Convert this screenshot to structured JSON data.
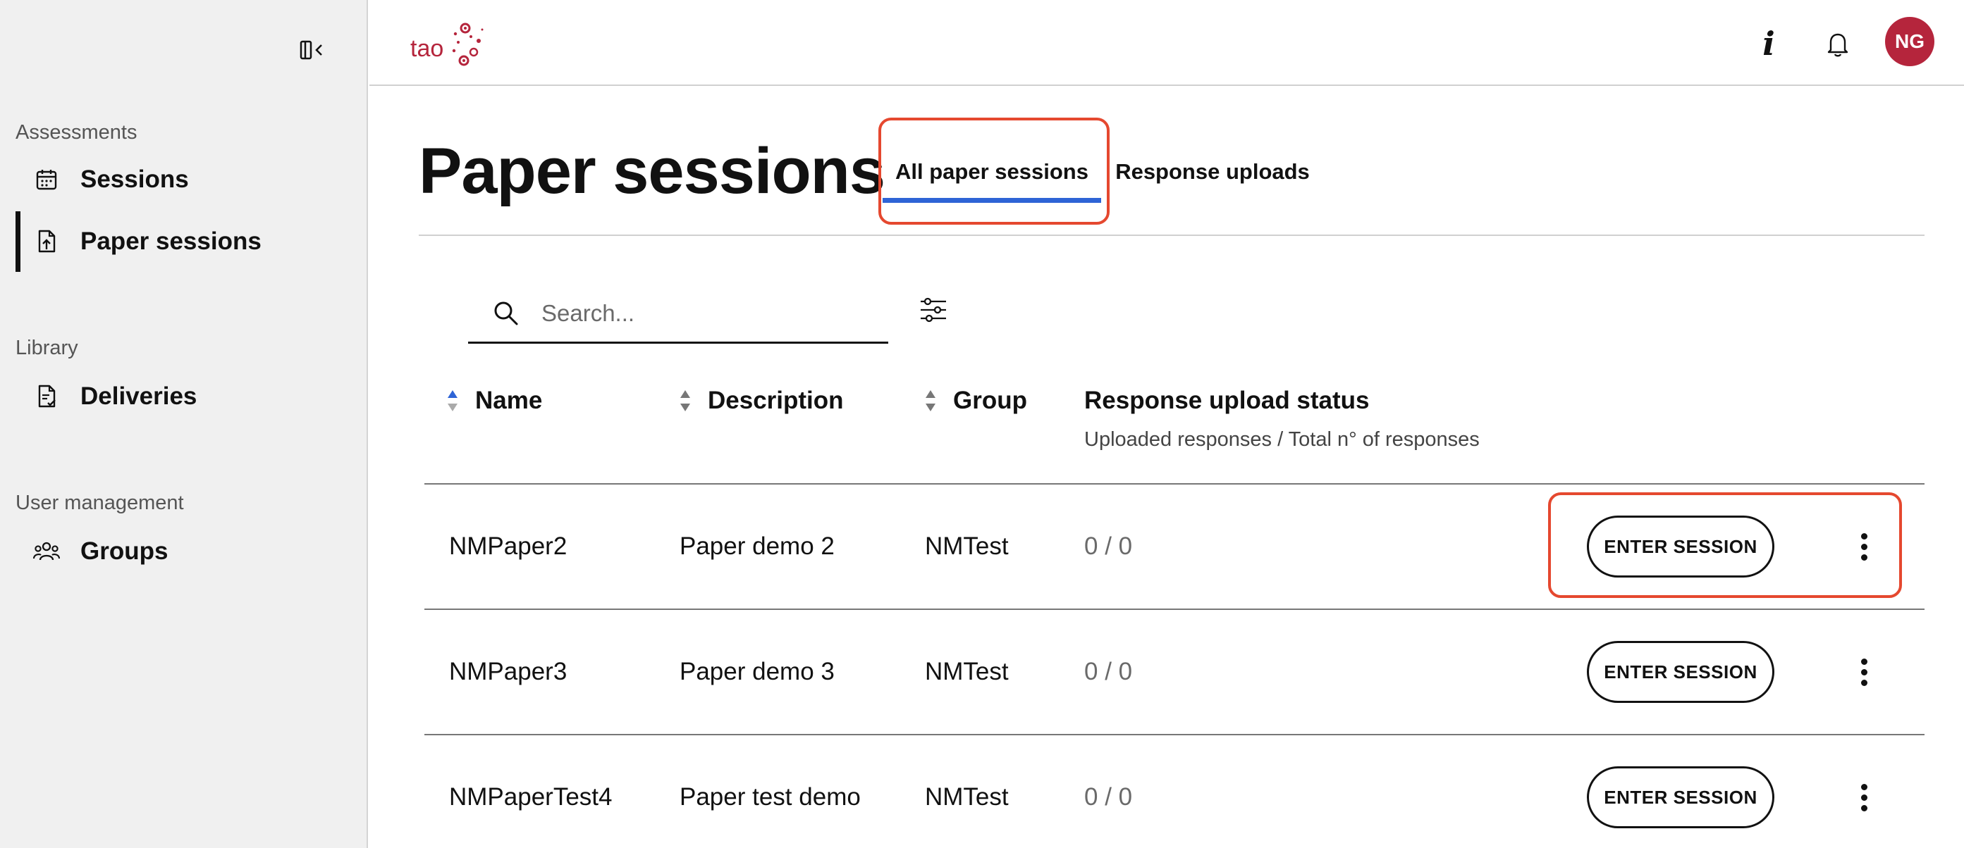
{
  "sidebar": {
    "sections": [
      {
        "title": "Assessments",
        "items": [
          {
            "label": "Sessions"
          },
          {
            "label": "Paper sessions"
          }
        ]
      },
      {
        "title": "Library",
        "items": [
          {
            "label": "Deliveries"
          }
        ]
      },
      {
        "title": "User management",
        "items": [
          {
            "label": "Groups"
          }
        ]
      }
    ],
    "active_item": "Paper sessions"
  },
  "header": {
    "logo_text": "tao",
    "user_initials": "NG",
    "info_label": "i",
    "colors": {
      "avatar_bg": "#b5253c",
      "logo": "#b5253c"
    }
  },
  "main": {
    "title": "Paper sessions",
    "tabs": [
      {
        "label": "All paper sessions",
        "active": true
      },
      {
        "label": "Response uploads",
        "active": false
      }
    ],
    "search": {
      "placeholder": "Search...",
      "value": ""
    },
    "table": {
      "columns": [
        {
          "label": "Name",
          "sort": "ascending"
        },
        {
          "label": "Description",
          "sort": "none"
        },
        {
          "label": "Group",
          "sort": "none"
        },
        {
          "label": "Response upload status",
          "sublabel": "Uploaded responses / Total n° of responses"
        }
      ],
      "rows": [
        {
          "name": "NMPaper2",
          "description": "Paper demo 2",
          "group": "NMTest",
          "status": "0 / 0",
          "action": "ENTER SESSION"
        },
        {
          "name": "NMPaper3",
          "description": "Paper demo 3",
          "group": "NMTest",
          "status": "0 / 0",
          "action": "ENTER SESSION"
        },
        {
          "name": "NMPaperTest4",
          "description": "Paper test demo",
          "group": "NMTest",
          "status": "0 / 0",
          "action": "ENTER SESSION"
        }
      ]
    }
  },
  "colors": {
    "accent": "#2e64d6",
    "highlight": "#e5482f"
  }
}
